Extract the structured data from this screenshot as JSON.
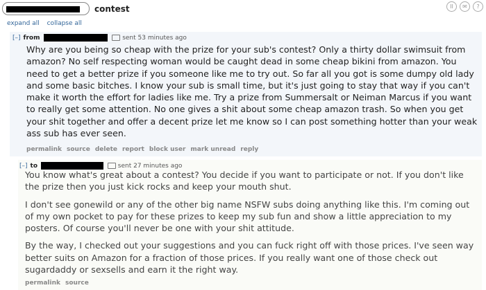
{
  "header": {
    "subject": "contest"
  },
  "toolbar": {
    "expand_all": "expand all",
    "collapse_all": "collapse all"
  },
  "message1": {
    "toggle": "[–]",
    "direction": "from",
    "time": "sent 53 minutes ago",
    "body": "Why are you being so cheap with the prize for your sub's contest? Only a thirty dollar swimsuit from amazon? No self respecting woman would be caught dead in some cheap bikini from amazon. You need to get a better prize if you someone like me to try out. So far all you got is some dumpy old lady and some basic bitches. I know your sub is small time, but it's just going to stay that way if you can't make it worth the effort for ladies like me. Try a prize from Summersalt or Neiman Marcus if you want to really get some attention. No one gives a shit about some cheap amazon trash. So when you get your shit together and offer a decent prize let me know so I can post something hotter than your weak ass sub has ever seen.",
    "actions": [
      "permalink",
      "source",
      "delete",
      "report",
      "block user",
      "mark unread",
      "reply"
    ]
  },
  "message2": {
    "toggle": "[–]",
    "direction": "to",
    "time": "sent 27 minutes ago",
    "paragraphs": [
      "You know what's great about a contest? You decide if you want to participate or not. If you don't like the prize then you just kick rocks and keep your mouth shut.",
      "I don't see gonewild or any of the other big name NSFW subs doing anything like this. I'm coming out of my own pocket to pay for these prizes to keep my sub fun and show a little appreciation to my posters. Of course you'll never be one with your shit attitude.",
      "By the way, I checked out your suggestions and you can fuck right off with those prices. I've seen way better suits on Amazon for a fraction of those prices. If you really want one of those check out sugardaddy or sexsells and earn it the right way."
    ],
    "actions": [
      "permalink",
      "source"
    ]
  }
}
